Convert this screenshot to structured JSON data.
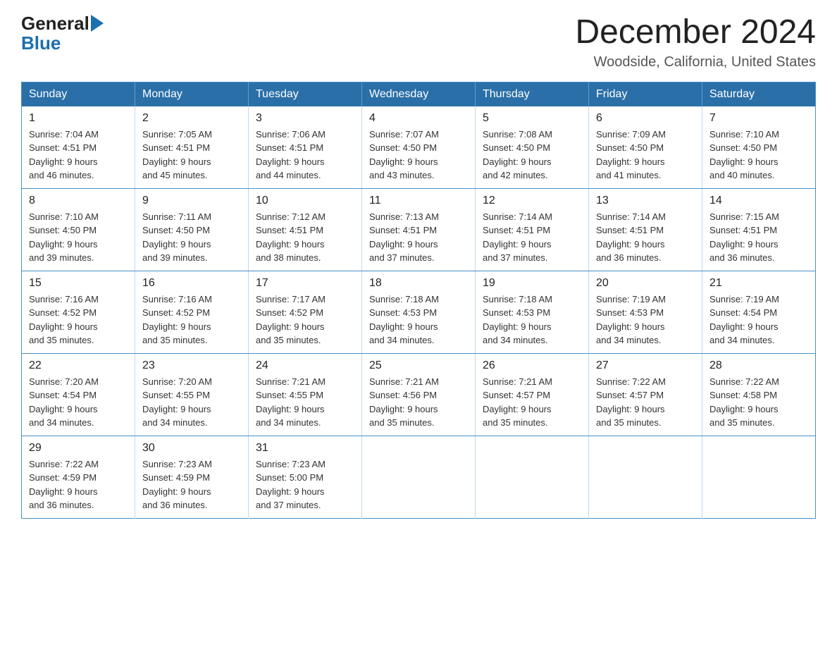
{
  "header": {
    "logo_general": "General",
    "logo_blue": "Blue",
    "month_title": "December 2024",
    "location": "Woodside, California, United States"
  },
  "days_of_week": [
    "Sunday",
    "Monday",
    "Tuesday",
    "Wednesday",
    "Thursday",
    "Friday",
    "Saturday"
  ],
  "weeks": [
    [
      {
        "day": "1",
        "sunrise": "7:04 AM",
        "sunset": "4:51 PM",
        "daylight": "9 hours and 46 minutes."
      },
      {
        "day": "2",
        "sunrise": "7:05 AM",
        "sunset": "4:51 PM",
        "daylight": "9 hours and 45 minutes."
      },
      {
        "day": "3",
        "sunrise": "7:06 AM",
        "sunset": "4:51 PM",
        "daylight": "9 hours and 44 minutes."
      },
      {
        "day": "4",
        "sunrise": "7:07 AM",
        "sunset": "4:50 PM",
        "daylight": "9 hours and 43 minutes."
      },
      {
        "day": "5",
        "sunrise": "7:08 AM",
        "sunset": "4:50 PM",
        "daylight": "9 hours and 42 minutes."
      },
      {
        "day": "6",
        "sunrise": "7:09 AM",
        "sunset": "4:50 PM",
        "daylight": "9 hours and 41 minutes."
      },
      {
        "day": "7",
        "sunrise": "7:10 AM",
        "sunset": "4:50 PM",
        "daylight": "9 hours and 40 minutes."
      }
    ],
    [
      {
        "day": "8",
        "sunrise": "7:10 AM",
        "sunset": "4:50 PM",
        "daylight": "9 hours and 39 minutes."
      },
      {
        "day": "9",
        "sunrise": "7:11 AM",
        "sunset": "4:50 PM",
        "daylight": "9 hours and 39 minutes."
      },
      {
        "day": "10",
        "sunrise": "7:12 AM",
        "sunset": "4:51 PM",
        "daylight": "9 hours and 38 minutes."
      },
      {
        "day": "11",
        "sunrise": "7:13 AM",
        "sunset": "4:51 PM",
        "daylight": "9 hours and 37 minutes."
      },
      {
        "day": "12",
        "sunrise": "7:14 AM",
        "sunset": "4:51 PM",
        "daylight": "9 hours and 37 minutes."
      },
      {
        "day": "13",
        "sunrise": "7:14 AM",
        "sunset": "4:51 PM",
        "daylight": "9 hours and 36 minutes."
      },
      {
        "day": "14",
        "sunrise": "7:15 AM",
        "sunset": "4:51 PM",
        "daylight": "9 hours and 36 minutes."
      }
    ],
    [
      {
        "day": "15",
        "sunrise": "7:16 AM",
        "sunset": "4:52 PM",
        "daylight": "9 hours and 35 minutes."
      },
      {
        "day": "16",
        "sunrise": "7:16 AM",
        "sunset": "4:52 PM",
        "daylight": "9 hours and 35 minutes."
      },
      {
        "day": "17",
        "sunrise": "7:17 AM",
        "sunset": "4:52 PM",
        "daylight": "9 hours and 35 minutes."
      },
      {
        "day": "18",
        "sunrise": "7:18 AM",
        "sunset": "4:53 PM",
        "daylight": "9 hours and 34 minutes."
      },
      {
        "day": "19",
        "sunrise": "7:18 AM",
        "sunset": "4:53 PM",
        "daylight": "9 hours and 34 minutes."
      },
      {
        "day": "20",
        "sunrise": "7:19 AM",
        "sunset": "4:53 PM",
        "daylight": "9 hours and 34 minutes."
      },
      {
        "day": "21",
        "sunrise": "7:19 AM",
        "sunset": "4:54 PM",
        "daylight": "9 hours and 34 minutes."
      }
    ],
    [
      {
        "day": "22",
        "sunrise": "7:20 AM",
        "sunset": "4:54 PM",
        "daylight": "9 hours and 34 minutes."
      },
      {
        "day": "23",
        "sunrise": "7:20 AM",
        "sunset": "4:55 PM",
        "daylight": "9 hours and 34 minutes."
      },
      {
        "day": "24",
        "sunrise": "7:21 AM",
        "sunset": "4:55 PM",
        "daylight": "9 hours and 34 minutes."
      },
      {
        "day": "25",
        "sunrise": "7:21 AM",
        "sunset": "4:56 PM",
        "daylight": "9 hours and 35 minutes."
      },
      {
        "day": "26",
        "sunrise": "7:21 AM",
        "sunset": "4:57 PM",
        "daylight": "9 hours and 35 minutes."
      },
      {
        "day": "27",
        "sunrise": "7:22 AM",
        "sunset": "4:57 PM",
        "daylight": "9 hours and 35 minutes."
      },
      {
        "day": "28",
        "sunrise": "7:22 AM",
        "sunset": "4:58 PM",
        "daylight": "9 hours and 35 minutes."
      }
    ],
    [
      {
        "day": "29",
        "sunrise": "7:22 AM",
        "sunset": "4:59 PM",
        "daylight": "9 hours and 36 minutes."
      },
      {
        "day": "30",
        "sunrise": "7:23 AM",
        "sunset": "4:59 PM",
        "daylight": "9 hours and 36 minutes."
      },
      {
        "day": "31",
        "sunrise": "7:23 AM",
        "sunset": "5:00 PM",
        "daylight": "9 hours and 37 minutes."
      },
      null,
      null,
      null,
      null
    ]
  ],
  "labels": {
    "sunrise": "Sunrise:",
    "sunset": "Sunset:",
    "daylight": "Daylight:"
  }
}
